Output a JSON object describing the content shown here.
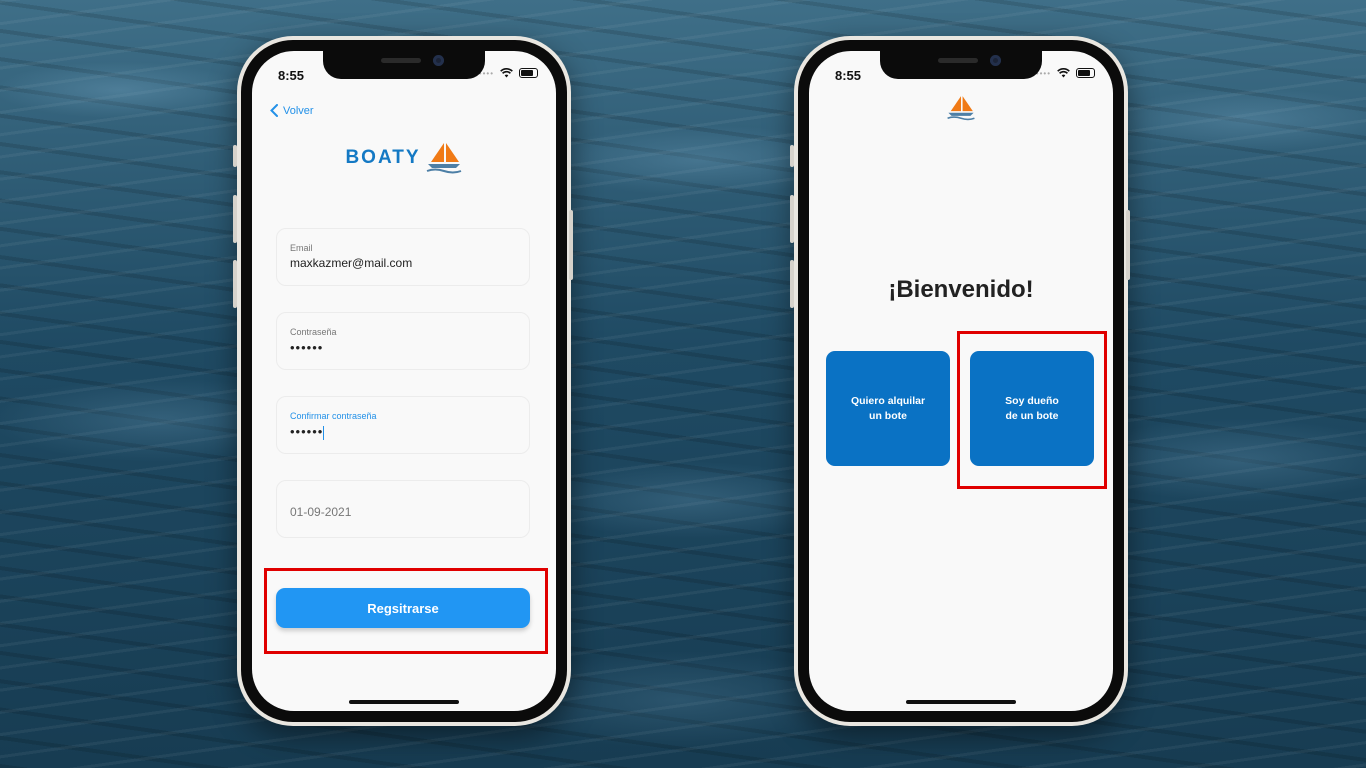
{
  "left_phone": {
    "status_time": "8:55",
    "back_label": "Volver",
    "brand_name": "BOATY",
    "fields": [
      {
        "label": "Email",
        "value": "maxkazmer@mail.com"
      },
      {
        "label": "Contraseña",
        "value": "••••••"
      },
      {
        "label": "Confirmar contraseña",
        "value": "••••••"
      },
      {
        "label": "",
        "value": "01-09-2021"
      }
    ],
    "register_label": "Regsitrarse"
  },
  "right_phone": {
    "status_time": "8:55",
    "welcome": "¡Bienvenido!",
    "options": [
      {
        "line1": "Quiero alquilar",
        "line2": "un bote"
      },
      {
        "line1": "Soy dueño",
        "line2": "de un bote"
      }
    ]
  },
  "colors": {
    "primary_blue": "#2196f3",
    "dark_blue": "#0a72c4",
    "brand_blue": "#1479c4",
    "sail_orange": "#f07a16",
    "highlight_red": "#e00000"
  },
  "icons": [
    "chevron-left-icon",
    "sailboat-logo",
    "wifi-icon",
    "battery-icon"
  ]
}
